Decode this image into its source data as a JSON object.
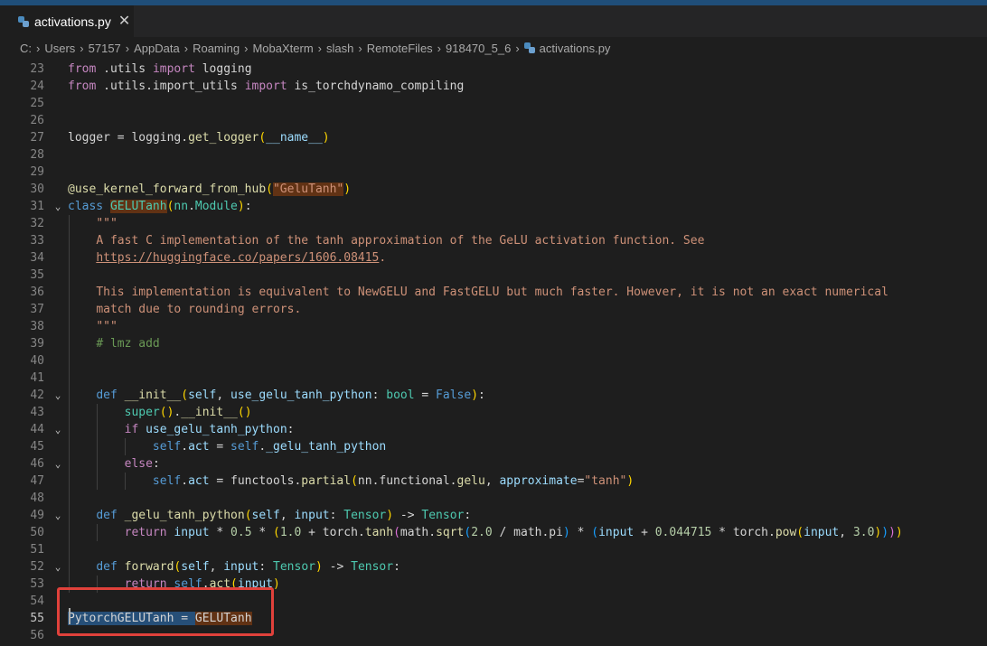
{
  "tab": {
    "label": "activations.py",
    "close": "✕"
  },
  "breadcrumb": [
    "C:",
    "Users",
    "57157",
    "AppData",
    "Roaming",
    "MobaXterm",
    "slash",
    "RemoteFiles",
    "918470_5_6",
    "activations.py"
  ],
  "lines": [
    {
      "num": "23",
      "text": "from .utils import logging"
    },
    {
      "num": "24",
      "text": "from .utils.import_utils import is_torchdynamo_compiling"
    },
    {
      "num": "25",
      "text": ""
    },
    {
      "num": "26",
      "text": ""
    },
    {
      "num": "27",
      "text": "logger = logging.get_logger(__name__)"
    },
    {
      "num": "28",
      "text": ""
    },
    {
      "num": "29",
      "text": ""
    },
    {
      "num": "30",
      "text": "@use_kernel_forward_from_hub(\"GeluTanh\")"
    },
    {
      "num": "31",
      "text": "class GELUTanh(nn.Module):"
    },
    {
      "num": "32",
      "text": "    \"\"\""
    },
    {
      "num": "33",
      "text": "    A fast C implementation of the tanh approximation of the GeLU activation function. See"
    },
    {
      "num": "34",
      "text": "    https://huggingface.co/papers/1606.08415."
    },
    {
      "num": "35",
      "text": ""
    },
    {
      "num": "36",
      "text": "    This implementation is equivalent to NewGELU and FastGELU but much faster. However, it is not an exact numerical"
    },
    {
      "num": "37",
      "text": "    match due to rounding errors."
    },
    {
      "num": "38",
      "text": "    \"\"\""
    },
    {
      "num": "39",
      "text": "    # lmz add"
    },
    {
      "num": "40",
      "text": ""
    },
    {
      "num": "41",
      "text": ""
    },
    {
      "num": "42",
      "text": "    def __init__(self, use_gelu_tanh_python: bool = False):"
    },
    {
      "num": "43",
      "text": "        super().__init__()"
    },
    {
      "num": "44",
      "text": "        if use_gelu_tanh_python:"
    },
    {
      "num": "45",
      "text": "            self.act = self._gelu_tanh_python"
    },
    {
      "num": "46",
      "text": "        else:"
    },
    {
      "num": "47",
      "text": "            self.act = functools.partial(nn.functional.gelu, approximate=\"tanh\")"
    },
    {
      "num": "48",
      "text": ""
    },
    {
      "num": "49",
      "text": "    def _gelu_tanh_python(self, input: Tensor) -> Tensor:"
    },
    {
      "num": "50",
      "text": "        return input * 0.5 * (1.0 + torch.tanh(math.sqrt(2.0 / math.pi) * (input + 0.044715 * torch.pow(input, 3.0))))"
    },
    {
      "num": "51",
      "text": ""
    },
    {
      "num": "52",
      "text": "    def forward(self, input: Tensor) -> Tensor:"
    },
    {
      "num": "53",
      "text": "        return self.act(input)"
    },
    {
      "num": "54",
      "text": ""
    },
    {
      "num": "55",
      "text": "PytorchGELUTanh = GELUTanh"
    },
    {
      "num": "56",
      "text": ""
    }
  ],
  "colors": {
    "accent": "#1f4e79",
    "highlight_box": "#e0413b",
    "background": "#1e1e1e"
  }
}
